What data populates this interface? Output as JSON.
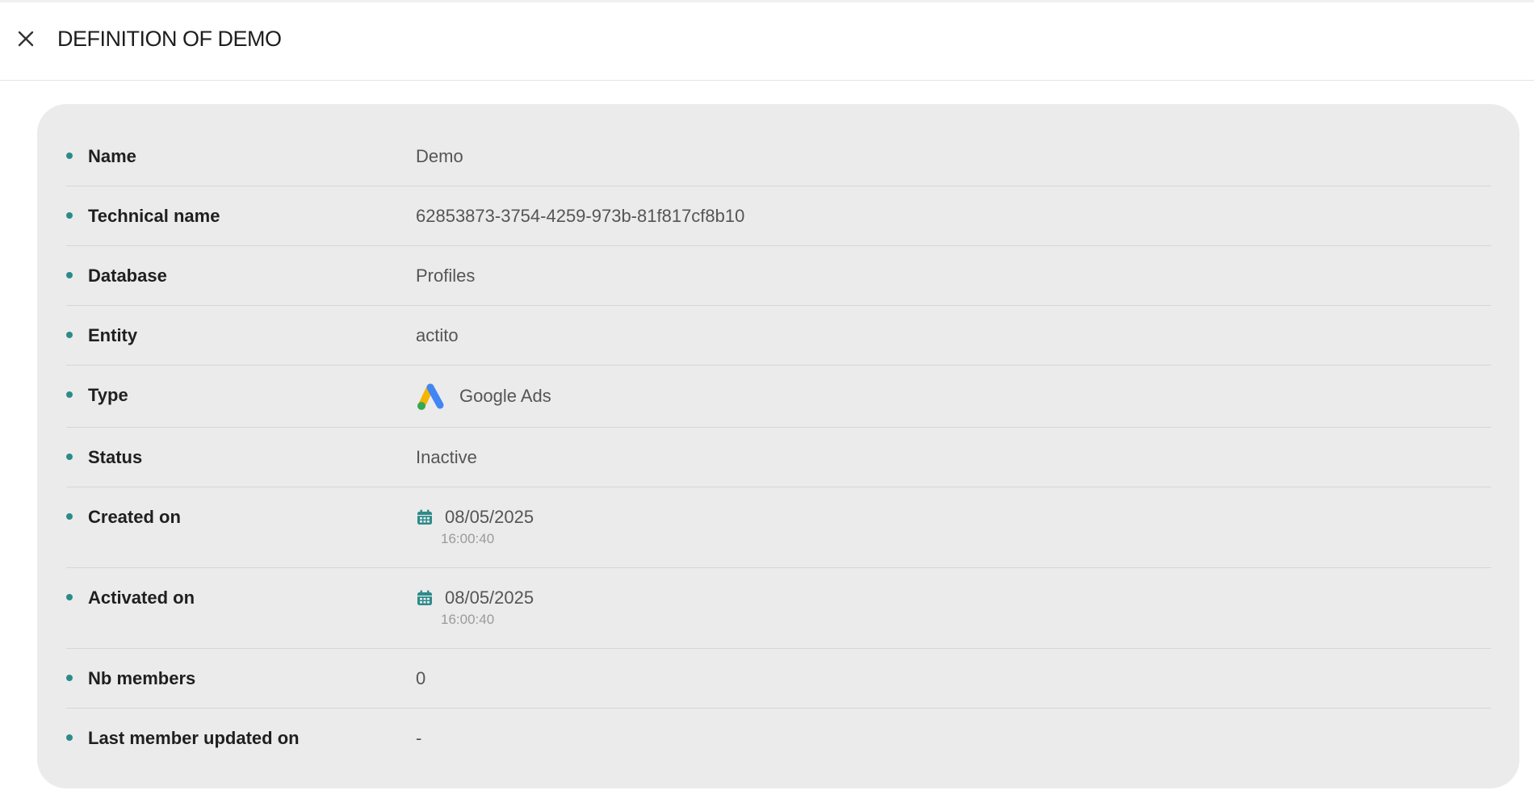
{
  "header": {
    "title": "DEFINITION OF DEMO",
    "close_icon": "close-icon"
  },
  "definition": {
    "name": {
      "label": "Name",
      "value": "Demo"
    },
    "technical_name": {
      "label": "Technical name",
      "value": "62853873-3754-4259-973b-81f817cf8b10"
    },
    "database": {
      "label": "Database",
      "value": "Profiles"
    },
    "entity": {
      "label": "Entity",
      "value": "actito"
    },
    "type": {
      "label": "Type",
      "value": "Google Ads",
      "icon": "google-ads-logo"
    },
    "status": {
      "label": "Status",
      "value": "Inactive"
    },
    "created_on": {
      "label": "Created on",
      "date": "08/05/2025",
      "time": "16:00:40",
      "icon": "calendar-icon"
    },
    "activated_on": {
      "label": "Activated on",
      "date": "08/05/2025",
      "time": "16:00:40",
      "icon": "calendar-icon"
    },
    "nb_members": {
      "label": "Nb members",
      "value": "0"
    },
    "last_member_updated_on": {
      "label": "Last member updated on",
      "value": "-"
    }
  },
  "colors": {
    "bullet": "#2c8b8a",
    "calendar_icon": "#2c8b8a",
    "panel_background": "#ebebeb",
    "ads_yellow": "#f4b400",
    "ads_blue": "#4285f4",
    "ads_green": "#34a853"
  }
}
